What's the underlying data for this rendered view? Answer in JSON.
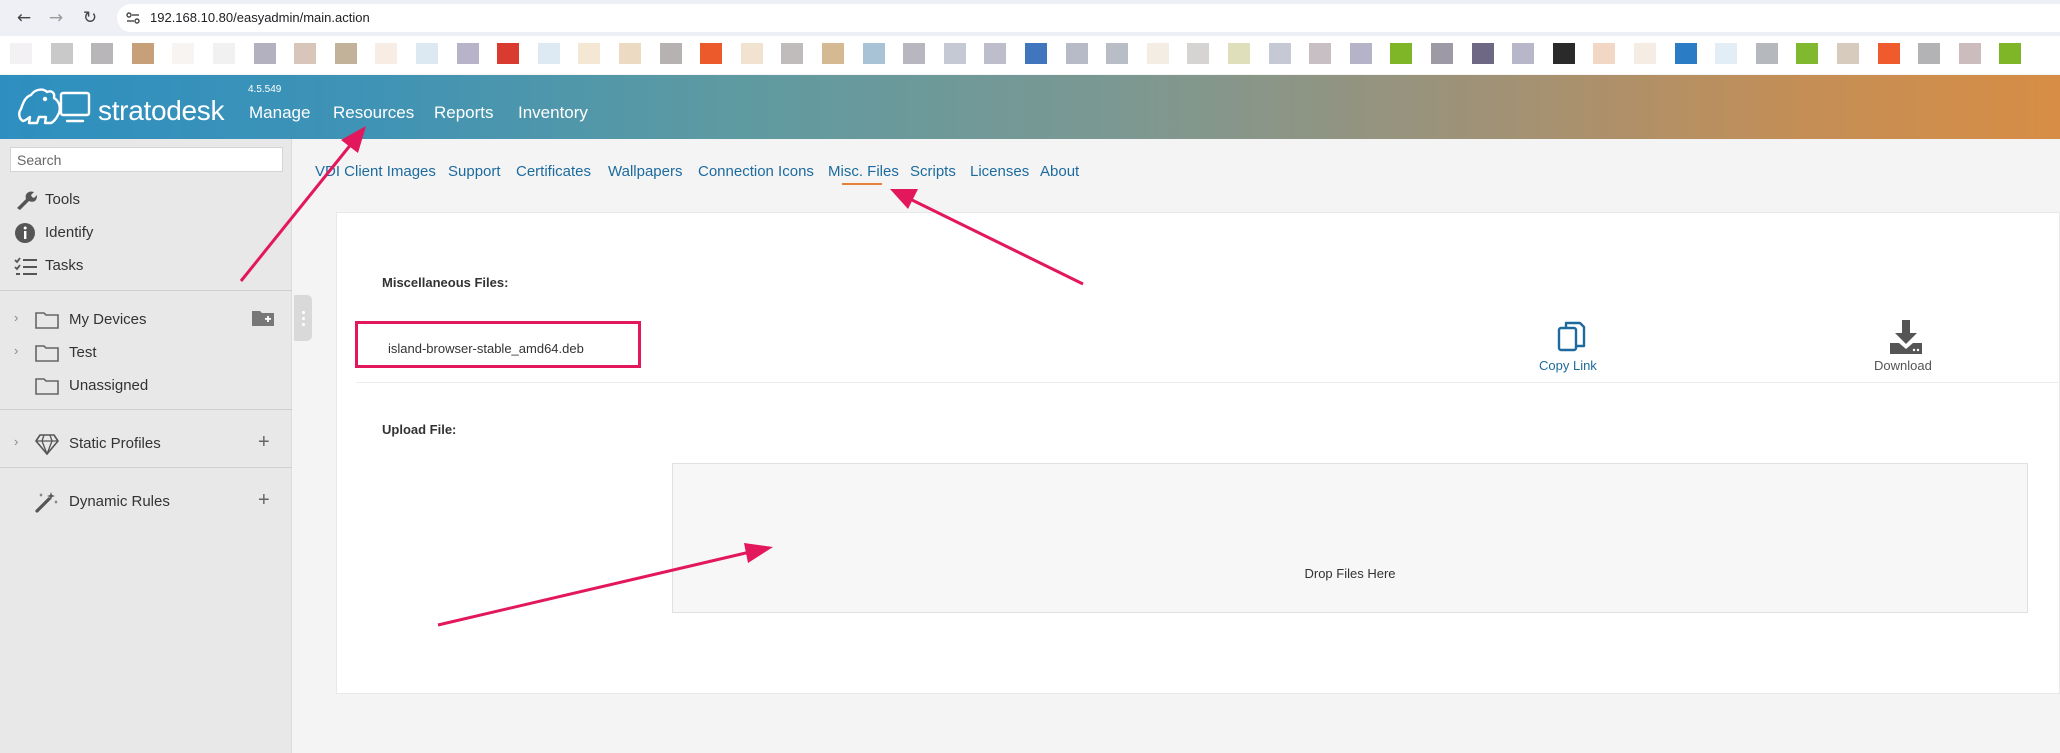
{
  "browser": {
    "url": "192.168.10.80/easyadmin/main.action",
    "icons": [
      "back-arrow-icon",
      "forward-arrow-icon",
      "reload-icon",
      "site-info-icon"
    ]
  },
  "bookmarks": {
    "colors": [
      "#f3f1f3",
      "#c9c9c9",
      "#b9b6b9",
      "#c7a079",
      "#f8f4f1",
      "#f1f1f1",
      "#b3b1c0",
      "#d7c6b9",
      "#c2b299",
      "#f7ede5",
      "#dce8f2",
      "#b8b3c9",
      "#d93c2f",
      "#dde9f3",
      "#f4e7d3",
      "#ecdac2",
      "#b6b2b1",
      "#ec5a2b",
      "#f1e3d0",
      "#c0bcbb",
      "#d5b992",
      "#a9c3d6",
      "#b8b7bf",
      "#c4c9d3",
      "#bdbdcc",
      "#3f76bd",
      "#b7bbc7",
      "#b9bdc6",
      "#f3ede4",
      "#d6d4d3",
      "#dfe0bb",
      "#c4c9d3",
      "#c8bfc4",
      "#b5b3c8",
      "#7fb628",
      "#9d99a5",
      "#6e6885",
      "#b8b6c9",
      "#2a2a2a",
      "#f2d8c4",
      "#f5ede4",
      "#2a7dc4",
      "#e3edf5",
      "#b5b8bd",
      "#80b82f",
      "#d6cbbd",
      "#ef5b2d",
      "#b3b3b5",
      "#cdbcbd",
      "#7fb628"
    ]
  },
  "header": {
    "logo_text": "stratodesk",
    "version": "4.5.549",
    "menu": [
      "Manage",
      "Resources",
      "Reports",
      "Inventory"
    ]
  },
  "sidebar": {
    "search_placeholder": "Search",
    "tools": [
      {
        "label": "Tools",
        "icon": "wrench-icon"
      },
      {
        "label": "Identify",
        "icon": "info-icon"
      },
      {
        "label": "Tasks",
        "icon": "tasks-icon"
      }
    ],
    "folders": [
      {
        "label": "My Devices",
        "icon": "folder-icon",
        "expandable": true
      },
      {
        "label": "Test",
        "icon": "folder-icon",
        "expandable": true
      },
      {
        "label": "Unassigned",
        "icon": "folder-icon",
        "expandable": false
      }
    ],
    "static_profiles": {
      "label": "Static Profiles",
      "icon": "diamond-icon"
    },
    "dynamic_rules": {
      "label": "Dynamic Rules",
      "icon": "magic-wand-icon"
    },
    "add_icon": "plus-icon",
    "add_folder_icon": "folder-add-icon"
  },
  "subnav": {
    "tabs": [
      "VDI Client Images",
      "Support",
      "Certificates",
      "Wallpapers",
      "Connection Icons",
      "Misc. Files",
      "Scripts",
      "Licenses",
      "About"
    ],
    "active": "Misc. Files",
    "active_color": "#e57f3a"
  },
  "content": {
    "misc_title": "Miscellaneous Files:",
    "file_name": "island-browser-stable_amd64.deb",
    "copy_link_label": "Copy Link",
    "download_label": "Download",
    "upload_title": "Upload File:",
    "drop_text": "Drop Files Here",
    "link_color": "#1d6b9e"
  },
  "annotations": {
    "color": "#e3175c"
  }
}
